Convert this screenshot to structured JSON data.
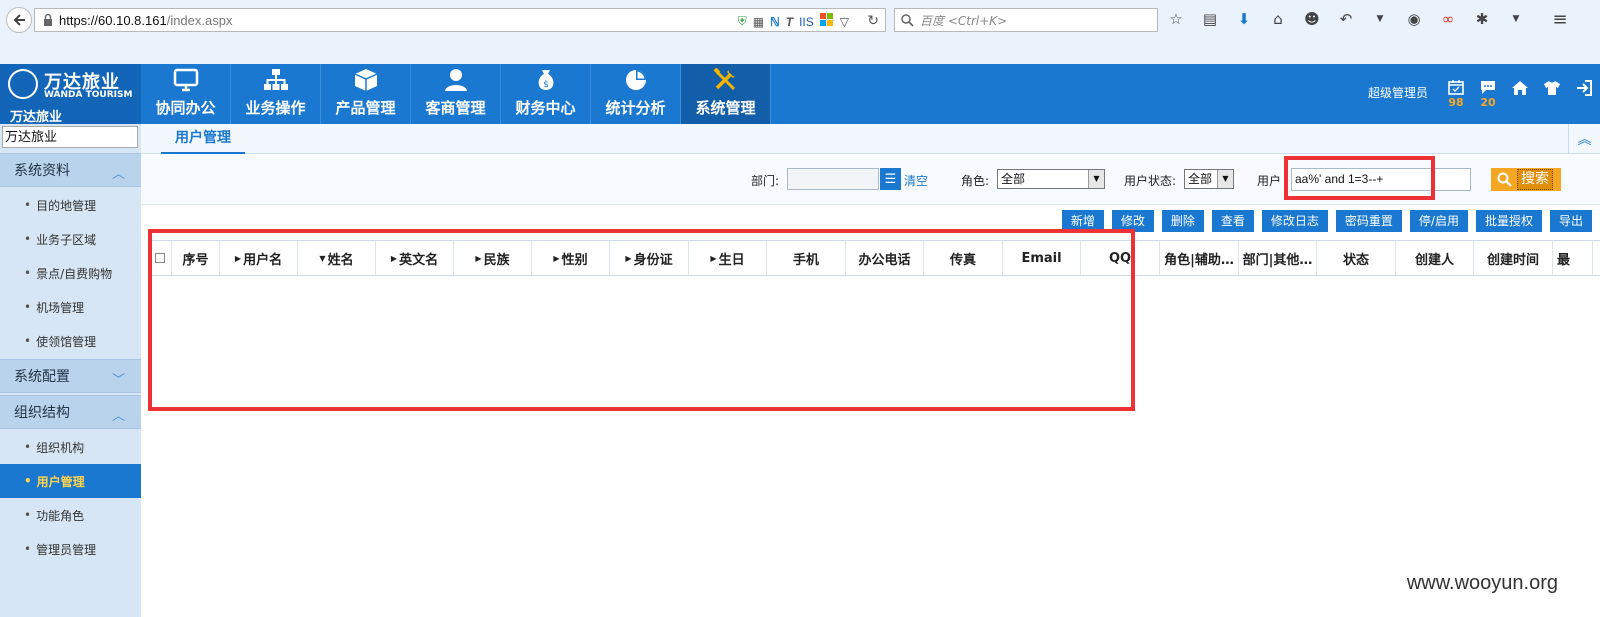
{
  "browser": {
    "url_host": "https://60.10.8.161",
    "url_path": "/index.aspx",
    "url_icon_text": "IIS",
    "search_placeholder": "百度 <Ctrl+K>"
  },
  "app": {
    "logo_cn": "万达旅业",
    "logo_en": "WANDA TOURISM",
    "logo_sub": "万达旅业",
    "menu": [
      {
        "label": "协同办公"
      },
      {
        "label": "业务操作"
      },
      {
        "label": "产品管理"
      },
      {
        "label": "客商管理"
      },
      {
        "label": "财务中心"
      },
      {
        "label": "统计分析"
      },
      {
        "label": "系统管理"
      }
    ],
    "admin_label": "超级管理员",
    "calendar_badge": "98",
    "message_badge": "20"
  },
  "sidebar": {
    "company_value": "万达旅业",
    "sections": [
      {
        "title": "系统资料",
        "items": [
          "目的地管理",
          "业务子区域",
          "景点/自费购物",
          "机场管理",
          "使领馆管理"
        ]
      },
      {
        "title": "系统配置",
        "items": []
      },
      {
        "title": "组织结构",
        "items": [
          "组织机构",
          "用户管理",
          "功能角色",
          "管理员管理"
        ]
      }
    ]
  },
  "main": {
    "tab_label": "用户管理",
    "filters": {
      "dept_label": "部门:",
      "clear_label": "清空",
      "role_label": "角色:",
      "role_value": "全部",
      "status_label": "用户状态:",
      "status_value": "全部",
      "user_label": "用户",
      "user_value": "aa%' and 1=3--+",
      "search_label": "搜索"
    },
    "actions": [
      "新增",
      "修改",
      "删除",
      "查看",
      "修改日志",
      "密码重置",
      "停/启用",
      "批量授权",
      "导出"
    ],
    "columns": [
      "序号",
      "用户名",
      "姓名",
      "英文名",
      "民族",
      "性别",
      "身份证",
      "生日",
      "手机",
      "办公电话",
      "传真",
      "Email",
      "QQ",
      "角色|辅助…",
      "部门|其他…",
      "状态",
      "创建人",
      "创建时间",
      "最"
    ]
  },
  "watermark": "www.wooyun.org",
  "colors": {
    "primary": "#1b78d0",
    "highlight": "#ec3237",
    "search_button": "#f5a623",
    "badge": "#f6a623"
  }
}
